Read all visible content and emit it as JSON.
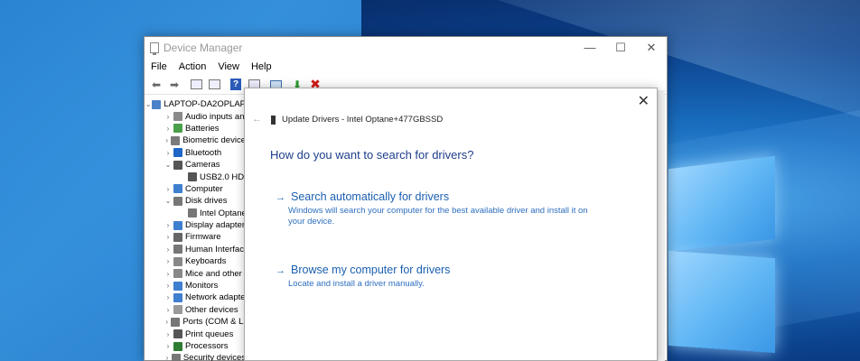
{
  "window": {
    "title": "Device Manager",
    "minimize": "—",
    "maximize": "☐",
    "close": "✕"
  },
  "menu": [
    "File",
    "Action",
    "View",
    "Help"
  ],
  "tree": {
    "root": "LAPTOP-DA2OPLAP",
    "items": [
      {
        "label": "Audio inputs an",
        "level": 1,
        "arrow": "›",
        "color": "#8a8a8a"
      },
      {
        "label": "Batteries",
        "level": 1,
        "arrow": "›",
        "color": "#4aa04a"
      },
      {
        "label": "Biometric device",
        "level": 1,
        "arrow": "›",
        "color": "#7a7a7a"
      },
      {
        "label": "Bluetooth",
        "level": 1,
        "arrow": "›",
        "color": "#1e66c8"
      },
      {
        "label": "Cameras",
        "level": 1,
        "arrow": "⌄",
        "color": "#555555"
      },
      {
        "label": "USB2.0 HD U",
        "level": 2,
        "arrow": "",
        "color": "#555555"
      },
      {
        "label": "Computer",
        "level": 1,
        "arrow": "›",
        "color": "#3f7fcf"
      },
      {
        "label": "Disk drives",
        "level": 1,
        "arrow": "⌄",
        "color": "#777777"
      },
      {
        "label": "Intel Optane",
        "level": 2,
        "arrow": "",
        "color": "#777777"
      },
      {
        "label": "Display adapter",
        "level": 1,
        "arrow": "›",
        "color": "#3f7fcf"
      },
      {
        "label": "Firmware",
        "level": 1,
        "arrow": "›",
        "color": "#666666"
      },
      {
        "label": "Human Interfac",
        "level": 1,
        "arrow": "›",
        "color": "#777777"
      },
      {
        "label": "Keyboards",
        "level": 1,
        "arrow": "›",
        "color": "#888888"
      },
      {
        "label": "Mice and other",
        "level": 1,
        "arrow": "›",
        "color": "#888888"
      },
      {
        "label": "Monitors",
        "level": 1,
        "arrow": "›",
        "color": "#3f7fcf"
      },
      {
        "label": "Network adapte",
        "level": 1,
        "arrow": "›",
        "color": "#3f7fcf"
      },
      {
        "label": "Other devices",
        "level": 1,
        "arrow": "›",
        "color": "#999999"
      },
      {
        "label": "Ports (COM & LI",
        "level": 1,
        "arrow": "›",
        "color": "#777777"
      },
      {
        "label": "Print queues",
        "level": 1,
        "arrow": "›",
        "color": "#555555"
      },
      {
        "label": "Processors",
        "level": 1,
        "arrow": "›",
        "color": "#2e7d32"
      },
      {
        "label": "Security devices",
        "level": 1,
        "arrow": "›",
        "color": "#777777"
      }
    ]
  },
  "dialog": {
    "close": "✕",
    "back": "←",
    "header": "Update Drivers - Intel Optane+477GBSSD",
    "question": "How do you want to search for drivers?",
    "option1": {
      "arrow": "→",
      "title": "Search automatically for drivers",
      "desc": "Windows will search your computer for the best available driver and install it on your device."
    },
    "option2": {
      "arrow": "→",
      "title": "Browse my computer for drivers",
      "desc": "Locate and install a driver manually."
    }
  }
}
